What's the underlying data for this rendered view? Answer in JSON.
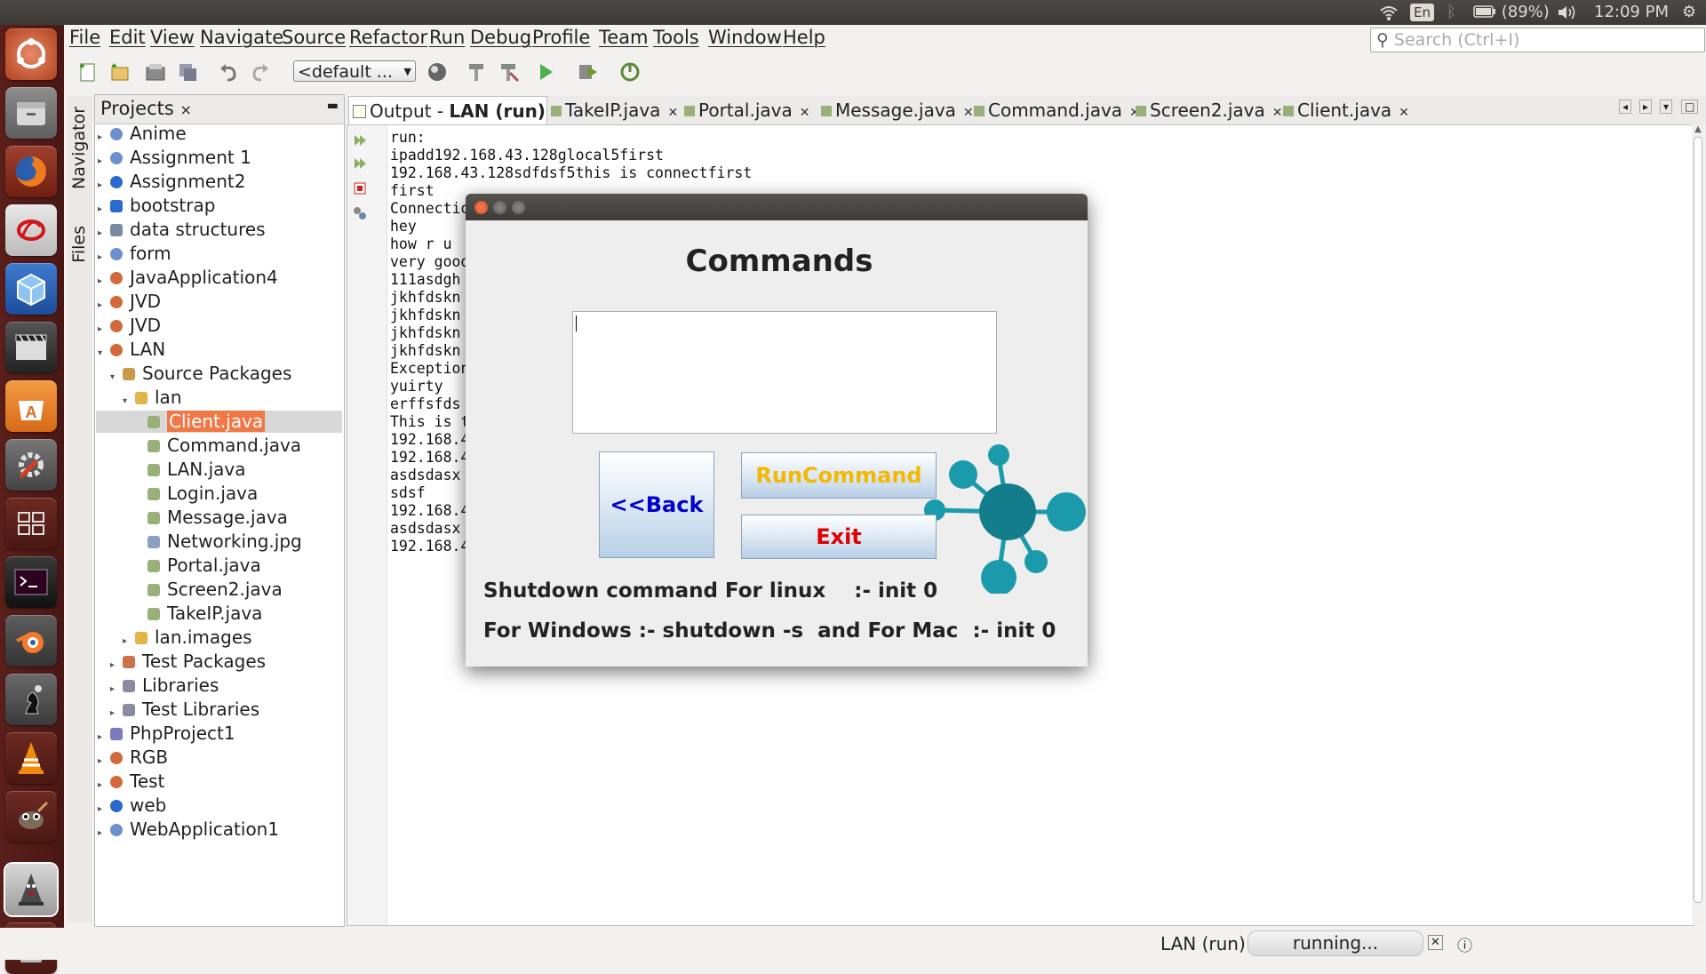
{
  "top_panel": {
    "language": "En",
    "battery": "(89%)",
    "time": "12:09 PM",
    "icons": [
      "wifi-icon",
      "bluetooth-icon",
      "battery-icon",
      "volume-icon",
      "gear-icon"
    ]
  },
  "launcher": {
    "items": [
      "ubuntu-dash-icon",
      "files-icon",
      "firefox-icon",
      "pdf-viewer-icon",
      "virtualbox-icon",
      "video-editor-icon",
      "software-center-icon",
      "system-settings-icon",
      "workspaces-icon",
      "terminal-icon",
      "blender-icon",
      "chess-icon",
      "vlc-icon",
      "gimp-icon",
      "netbeans-icon",
      "trash-icon"
    ]
  },
  "menubar": {
    "items": [
      "File",
      "Edit",
      "View",
      "Navigate",
      "Source",
      "Refactor",
      "Run",
      "Debug",
      "Profile",
      "Team",
      "Tools",
      "Window",
      "Help"
    ],
    "search_placeholder": "Search (Ctrl+I)"
  },
  "toolbar": {
    "config_value": "<default ..."
  },
  "side_tabs": {
    "navigator": "Navigator",
    "files": "Files"
  },
  "projects": {
    "tab_label": "Projects",
    "close": "×",
    "tree": [
      {
        "label": "Anime"
      },
      {
        "label": "Assignment 1"
      },
      {
        "label": "Assignment2"
      },
      {
        "label": "bootstrap"
      },
      {
        "label": "data structures"
      },
      {
        "label": "form"
      },
      {
        "label": "JavaApplication4"
      },
      {
        "label": "JVD"
      },
      {
        "label": "JVD"
      },
      {
        "label": "LAN"
      },
      {
        "label": "Source Packages"
      },
      {
        "label": "lan"
      },
      {
        "label": "Client.java"
      },
      {
        "label": "Command.java"
      },
      {
        "label": "LAN.java"
      },
      {
        "label": "Login.java"
      },
      {
        "label": "Message.java"
      },
      {
        "label": "Networking.jpg"
      },
      {
        "label": "Portal.java"
      },
      {
        "label": "Screen2.java"
      },
      {
        "label": "TakeIP.java"
      },
      {
        "label": "lan.images"
      },
      {
        "label": "Test Packages"
      },
      {
        "label": "Libraries"
      },
      {
        "label": "Test Libraries"
      },
      {
        "label": "PhpProject1"
      },
      {
        "label": "RGB"
      },
      {
        "label": "Test"
      },
      {
        "label": "web"
      },
      {
        "label": "WebApplication1"
      }
    ]
  },
  "editor_tabs": [
    {
      "prefix": "Output - ",
      "label": "LAN (run)"
    },
    {
      "label": "TakeIP.java"
    },
    {
      "label": "Portal.java"
    },
    {
      "label": "Message.java"
    },
    {
      "label": "Command.java"
    },
    {
      "label": "Screen2.java"
    },
    {
      "label": "Client.java"
    }
  ],
  "output_lines": [
    "run:",
    "ipadd192.168.43.128glocal5first",
    "192.168.43.128sdfdsf5this is connectfirst",
    "first",
    "Connectio",
    "hey",
    "how r u",
    "very good",
    "111asdgh",
    "jkhfdskn",
    "jkhfdskn",
    "jkhfdskn",
    "jkhfdskn",
    "Exception",
    "yuirty",
    "erffsfds",
    "This is t",
    "192.168.4",
    "192.168.4",
    "asdsdasx",
    "sdsf",
    "192.168.4",
    "asdsdasx",
    "192.168.4"
  ],
  "dialog": {
    "heading": "Commands",
    "command_text": "",
    "back_button": "<<Back",
    "run_button": "RunCommand",
    "exit_button": "Exit",
    "linux_text": "Shutdown command For linux    :- init 0",
    "windows_text": "For Windows :- shutdown -s  and For Mac  :- init 0",
    "colors": {
      "run": "#f5b800",
      "exit": "#e00000",
      "back": "#0000cc",
      "network": "#1a9aab"
    }
  },
  "statusbar": {
    "task": "LAN (run)",
    "status": "running..."
  }
}
